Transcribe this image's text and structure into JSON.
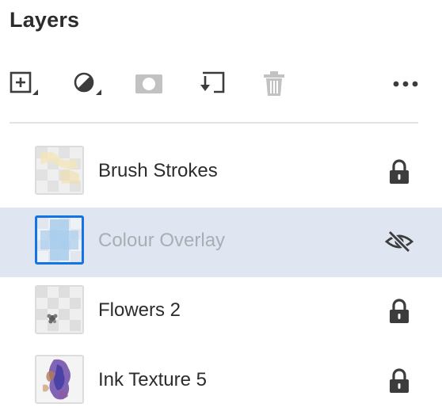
{
  "panel": {
    "title": "Layers"
  },
  "toolbar": {
    "tools": [
      {
        "name": "add-layer",
        "icon": "add-layer-icon",
        "enabled": true
      },
      {
        "name": "adjustment",
        "icon": "adjustment-icon",
        "enabled": true
      },
      {
        "name": "mask",
        "icon": "mask-icon",
        "enabled": false
      },
      {
        "name": "merge-down",
        "icon": "merge-down-icon",
        "enabled": true
      },
      {
        "name": "delete-layer",
        "icon": "trash-icon",
        "enabled": false
      },
      {
        "name": "more-options",
        "icon": "more-horizontal-icon",
        "enabled": true
      }
    ]
  },
  "layers": [
    {
      "name": "Brush Strokes",
      "state_icon": "lock-icon",
      "selected": false,
      "visible": true
    },
    {
      "name": "Colour Overlay",
      "state_icon": "eye-hidden-icon",
      "selected": true,
      "visible": false
    },
    {
      "name": "Flowers 2",
      "state_icon": "lock-icon",
      "selected": false,
      "visible": true
    },
    {
      "name": "Ink Texture 5",
      "state_icon": "lock-icon",
      "selected": false,
      "visible": true
    }
  ],
  "colors": {
    "selected_row": "#e0e6f1",
    "selected_thumb_border": "#1473e6",
    "text": "#2c2c2c",
    "hidden_text": "#a9adb4",
    "icon": "#3c3c3c",
    "icon_disabled": "#c2c2c2"
  }
}
